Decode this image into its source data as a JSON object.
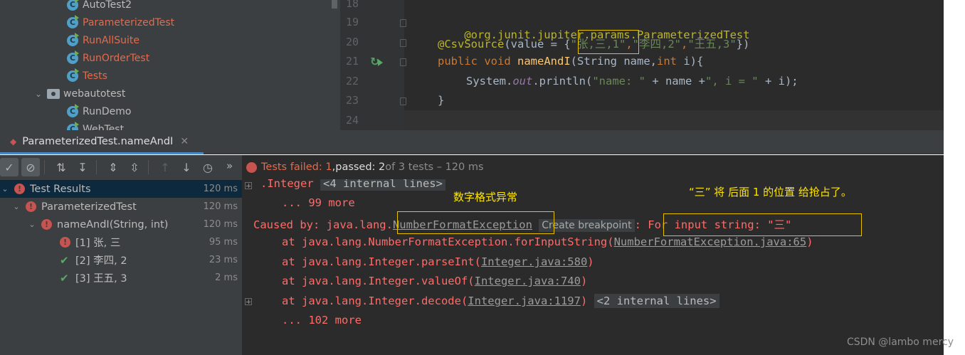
{
  "project_tree": {
    "items": [
      {
        "label": "AutoTest2"
      },
      {
        "label": "ParameterizedTest"
      },
      {
        "label": "RunAllSuite"
      },
      {
        "label": "RunOrderTest"
      },
      {
        "label": "Tests"
      },
      {
        "label": "webautotest"
      },
      {
        "label": "RunDemo"
      },
      {
        "label": "WebTest"
      }
    ]
  },
  "editor": {
    "line_numbers": [
      "18",
      "19",
      "20",
      "21",
      "22",
      "23",
      "24"
    ],
    "line19": {
      "annotation": "@org.junit.jupiter.params.ParameterizedTest"
    },
    "line20": {
      "annotation": "@CsvSource",
      "open": "(value = {",
      "s1": "\"张,三,1\"",
      "c1": ",",
      "s2": "\"李四,2\"",
      "c2": ",",
      "s3": "\"王五,3\"",
      "close": "})"
    },
    "line21": {
      "public": "public",
      "void": "void",
      "method": "nameAndI",
      "p1": "(String name,",
      "int": "int",
      "p2": " i){"
    },
    "line22": {
      "sys": "System.",
      "out": "out",
      "call": ".println(",
      "str1": "\"name: \"",
      "mid": " + name +",
      "str2": "\", i = \"",
      "end": " + i);"
    },
    "line23": {
      "brace": "}"
    }
  },
  "run_tab": {
    "label": "ParameterizedTest.nameAndI",
    "close": "✕"
  },
  "console_header": {
    "failed": "Tests failed: 1",
    "sep": ", ",
    "passed": "passed: 2",
    "rest": " of 3 tests – 120 ms"
  },
  "test_tree": [
    {
      "label": "Test Results",
      "time": "120 ms",
      "status": "failed"
    },
    {
      "label": "ParameterizedTest",
      "time": "120 ms",
      "status": "failed"
    },
    {
      "label": "nameAndI(String, int)",
      "time": "120 ms",
      "status": "failed"
    },
    {
      "label": "[1] 张, 三",
      "time": "95 ms",
      "status": "failed"
    },
    {
      "label": "[2] 李四, 2",
      "time": "23 ms",
      "status": "passed"
    },
    {
      "label": "[3] 王五, 3",
      "time": "2 ms",
      "status": "passed"
    }
  ],
  "console": {
    "l1_text": ".Integer",
    "l1_chip": "<4 internal lines>",
    "l2": "... 99 more",
    "l3_prefix": "Caused by: java.lang.",
    "l3_link": "NumberFormatException",
    "l3_bp": "Create breakpoint",
    "l3_suffix": ": For input string: \"三\"",
    "l4_prefix": "at java.lang.NumberFormatException.forInputString(",
    "l4_link": "NumberFormatException.java:65",
    "l4_suffix": ")",
    "l5_prefix": "at java.lang.Integer.parseInt(",
    "l5_link": "Integer.java:580",
    "l5_suffix": ")",
    "l6_prefix": "at java.lang.Integer.valueOf(",
    "l6_link": "Integer.java:740",
    "l6_suffix": ")",
    "l7_prefix": "at java.lang.Integer.decode(",
    "l7_link": "Integer.java:1197",
    "l7_suffix": ")",
    "l7_chip": "<2 internal lines>",
    "l8": "... 102 more"
  },
  "annotations": {
    "number_format": "数字格式异常",
    "explain": "“三” 将 后面 1 的位置 给抢占了。"
  },
  "watermark": "CSDN @lambo mercy",
  "colors": {
    "annotation_box": "#e5c100",
    "error": "#ff6b68",
    "pass": "#59a869",
    "fail_icon": "#c75450"
  }
}
